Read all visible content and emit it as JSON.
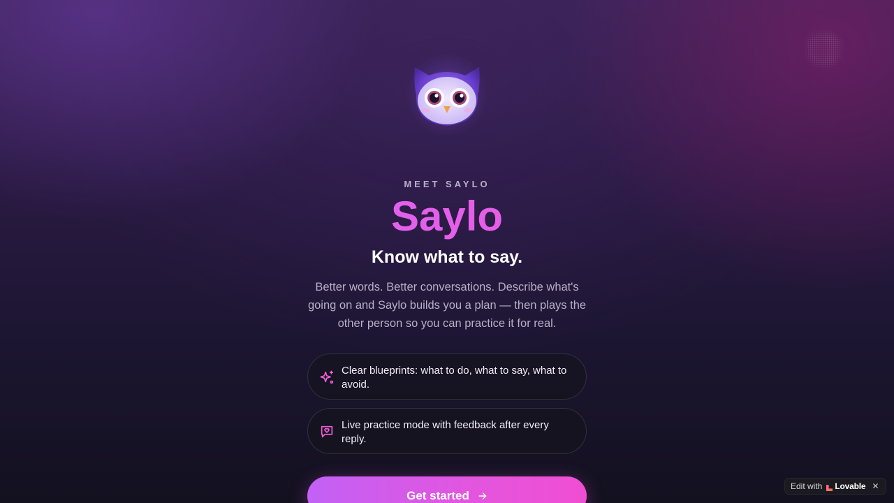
{
  "hero": {
    "eyebrow": "MEET SAYLO",
    "title": "Saylo",
    "tagline": "Know what to say.",
    "description": "Better words. Better conversations. Describe what's going on and Saylo builds you a plan — then plays the other person so you can practice it for real."
  },
  "features": [
    {
      "icon": "sparkles-icon",
      "text": "Clear blueprints: what to do, what to say, what to avoid."
    },
    {
      "icon": "message-heart-icon",
      "text": "Live practice mode with feedback after every reply."
    }
  ],
  "cta": {
    "label": "Get started",
    "icon": "arrow-right-icon"
  },
  "badge": {
    "edit_label": "Edit with",
    "brand": "Lovable",
    "close_icon": "close-icon"
  },
  "colors": {
    "accent_start": "#c261f6",
    "accent_end": "#f04ed2",
    "icon_pink": "#f35fd6",
    "background_dark": "#13111f"
  }
}
